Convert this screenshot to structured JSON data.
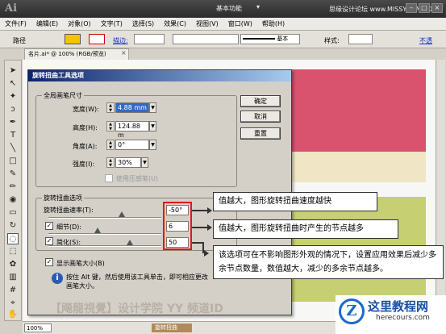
{
  "app": {
    "logo": "Ai",
    "workspace": "基本功能",
    "watermark_site": "思缘设计论坛 www.MISSYUAN.COM"
  },
  "menu": [
    "文件(F)",
    "编辑(E)",
    "对象(O)",
    "文字(T)",
    "选择(S)",
    "效果(C)",
    "视图(V)",
    "窗口(W)",
    "帮助(H)"
  ],
  "control_bar": {
    "label": "路径",
    "fill_color": "#f5c400",
    "stroke_color": "#d00000",
    "stroke_label": "描边:",
    "brush_value": "基本",
    "style_label": "样式:",
    "opacity_label": "不透"
  },
  "document": {
    "tab": "名片.ai* @ 100% (RGB/预览)",
    "zoom": "100%",
    "status_tool": "旋转扭曲"
  },
  "dialog": {
    "title": "旋转扭曲工具选项",
    "global_group": "全局画笔尺寸",
    "width_label": "宽度(W):",
    "width_value": "4.88 mm",
    "height_label": "高度(H):",
    "height_value": "124.88 m",
    "angle_label": "角度(A):",
    "angle_value": "0°",
    "intensity_label": "强度(I):",
    "intensity_value": "30%",
    "pressure_label": "使用压感笔(U)",
    "ok_button": "确定",
    "cancel_button": "取消",
    "reset_button": "重置",
    "twirl_group": "旋转扭曲选项",
    "rate_label": "旋转扭曲速率(T):",
    "rate_value": "-50°",
    "detail_label": "细节(D):",
    "detail_value": "6",
    "simplify_label": "简化(S):",
    "simplify_value": "50",
    "show_brush_label": "显示画笔大小(B)",
    "hint_text": "按住 Alt 键，然后使用该工具单击，即可相应更改画笔大小。"
  },
  "annotations": {
    "callout1": "值越大，图形旋转扭曲速度越快",
    "callout2": "值越大，图形旋转扭曲时产生的节点越多",
    "callout3": "该选项可在不影响图形外观的情况下，设置应用效果后减少多余节点数量，数值越大，减少的多余节点越多。",
    "arrow_color": "#333333",
    "highlight_color": "#e01818"
  },
  "branding": {
    "bottom_watermark": "【飚龍視覺】设计学院 YY 频道ID",
    "logo_letter": "Z",
    "name": "这里教程网",
    "url": "herecours.com"
  }
}
